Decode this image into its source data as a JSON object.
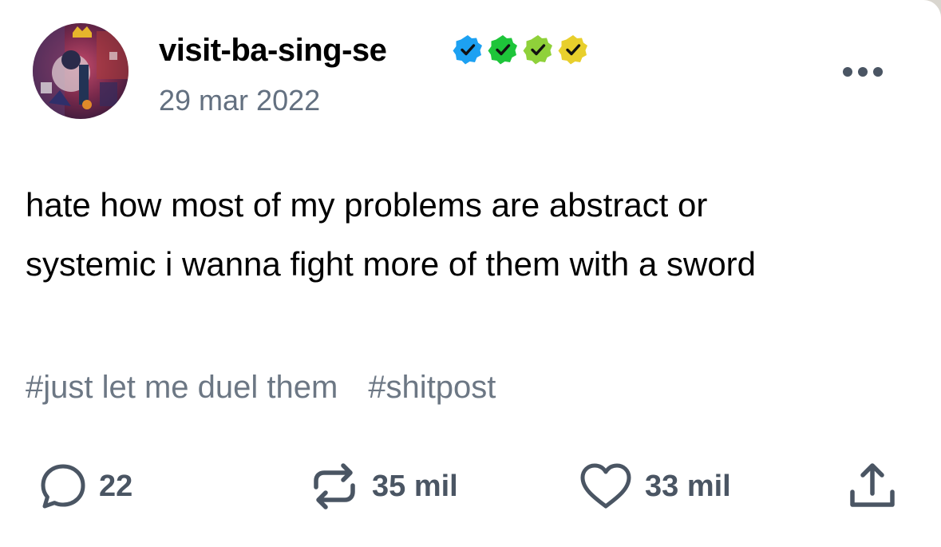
{
  "post": {
    "username": "visit-ba-sing-se",
    "date": "29 mar 2022",
    "body_lines": [
      "hate how most of my problems are abstract or",
      "systemic i wanna fight more of them with a sword"
    ],
    "tags": [
      "#just let me duel them",
      "#shitpost"
    ]
  },
  "badges": [
    {
      "name": "verified-badge-blue",
      "color": "#1da1f2"
    },
    {
      "name": "verified-badge-green",
      "color": "#1ec53a"
    },
    {
      "name": "verified-badge-lime",
      "color": "#8fd13a"
    },
    {
      "name": "verified-badge-yellow",
      "color": "#e8cf2c"
    }
  ],
  "actions": {
    "replies": {
      "icon": "comment-icon",
      "count": "22"
    },
    "reblogs": {
      "icon": "reblog-icon",
      "count": "35 mil"
    },
    "likes": {
      "icon": "heart-icon",
      "count": "33 mil"
    },
    "share": {
      "icon": "share-icon"
    }
  },
  "colors": {
    "date": "#637080",
    "tags": "#6c7784",
    "icons": "#4a5563"
  }
}
